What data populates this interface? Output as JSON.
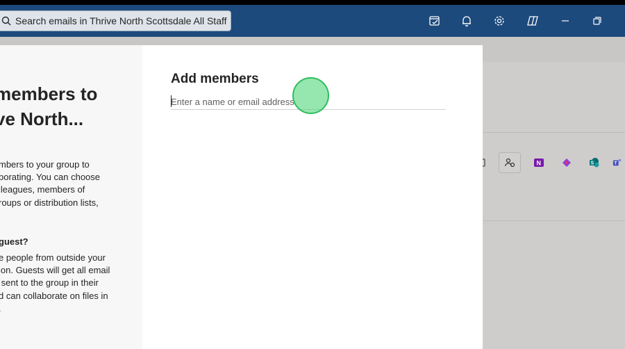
{
  "titlebar": {
    "search_text": "Search emails in Thrive North Scottsdale All Staff",
    "icons": [
      "search-icon",
      "todo-icon",
      "bell-icon",
      "gear-icon",
      "copilot-icon",
      "minimize-icon",
      "restore-icon"
    ]
  },
  "dialog": {
    "left": {
      "title_lines": [
        "members to",
        "ve North..."
      ],
      "para_lines": [
        "mbers to your group to",
        "borating. You can choose",
        "lleagues, members of",
        "roups or distribution lists,",
        ""
      ],
      "guest_heading": "guest?",
      "guest_lines": [
        "e people from outside your",
        "ion. Guests will get all email",
        " sent to the group in their",
        "d can collaborate on files in",
        "."
      ]
    },
    "right": {
      "title": "Add members",
      "input_placeholder": "Enter a name or email address",
      "input_value": ""
    }
  },
  "background_apps": [
    "calendar-icon",
    "people-settings-icon",
    "onenote-icon",
    "loop-icon",
    "sharepoint-icon",
    "teams-icon"
  ],
  "colors": {
    "titlebar": "#1d4a7c",
    "click_indicator": "#2ebd5c"
  }
}
